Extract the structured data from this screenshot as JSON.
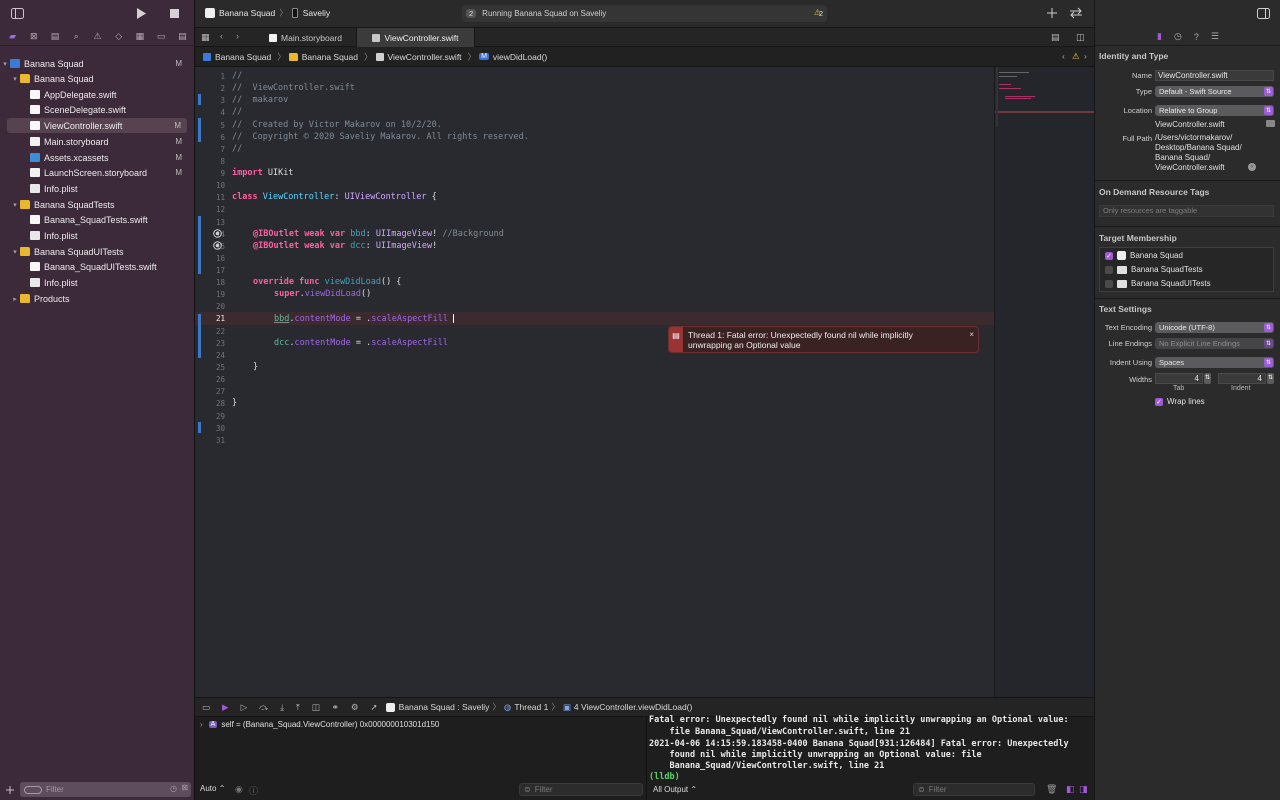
{
  "toolbar": {
    "scheme_name": "Banana Squad",
    "device_name": "Saveliy",
    "activity_count": "2",
    "activity_text": "Running Banana Squad on Saveliy",
    "warning_count": "2",
    "run_icon": "play-icon",
    "stop_icon": "stop-icon"
  },
  "tabs": [
    {
      "label": "Main.storyboard"
    },
    {
      "label": "ViewController.swift"
    }
  ],
  "jumpbar": {
    "crumbs": [
      "Banana Squad",
      "Banana Squad",
      "ViewController.swift",
      "viewDidLoad()"
    ],
    "method_badge": "M"
  },
  "navigator": {
    "items": [
      {
        "label": "Banana Squad",
        "flag": "M"
      },
      {
        "label": "Banana Squad",
        "flag": ""
      },
      {
        "label": "AppDelegate.swift",
        "flag": ""
      },
      {
        "label": "SceneDelegate.swift",
        "flag": ""
      },
      {
        "label": "ViewController.swift",
        "flag": "M"
      },
      {
        "label": "Main.storyboard",
        "flag": "M"
      },
      {
        "label": "Assets.xcassets",
        "flag": "M"
      },
      {
        "label": "LaunchScreen.storyboard",
        "flag": "M"
      },
      {
        "label": "Info.plist",
        "flag": ""
      },
      {
        "label": "Banana SquadTests",
        "flag": ""
      },
      {
        "label": "Banana_SquadTests.swift",
        "flag": ""
      },
      {
        "label": "Info.plist",
        "flag": ""
      },
      {
        "label": "Banana SquadUITests",
        "flag": ""
      },
      {
        "label": "Banana_SquadUITests.swift",
        "flag": ""
      },
      {
        "label": "Info.plist",
        "flag": ""
      },
      {
        "label": "Products",
        "flag": ""
      }
    ],
    "filter_placeholder": "Filter"
  },
  "editor": {
    "line_numbers": [
      "1",
      "2",
      "3",
      "4",
      "5",
      "6",
      "7",
      "8",
      "9",
      "10",
      "11",
      "12",
      "13",
      "14",
      "15",
      "16",
      "17",
      "18",
      "19",
      "20",
      "21",
      "22",
      "23",
      "24",
      "25",
      "26",
      "27",
      "28",
      "29",
      "30",
      "31"
    ],
    "code": {
      "l1": "//",
      "l2": "//  ViewController.swift",
      "l3": "//  makarov",
      "l4": "//",
      "l5": "//  Created by Victor Makarov on 10/2/20.",
      "l6": "//  Copyright © 2020 Saveliy Makarov. All rights reserved.",
      "l7": "//",
      "l9_kw": "import",
      "l9_rest": " UIKit",
      "l11_kw": "class",
      "l11_name": "ViewController",
      "l11_colon": ": ",
      "l11_super": "UIViewController",
      "l11_brace": " {",
      "l14_attr": "@IBOutlet",
      "l14_kw": "weak var",
      "l14_name": "bbd",
      "l14_colon": ": ",
      "l14_type": "UIImageView",
      "l14_bang": "! ",
      "l14_comment": "//Background",
      "l15_attr": "@IBOutlet",
      "l15_kw": "weak var",
      "l15_name": "dcc",
      "l15_colon": ": ",
      "l15_type": "UIImageView",
      "l15_bang": "!",
      "l18_kw": "override func",
      "l18_name": "viewDidLoad",
      "l18_rest": "() {",
      "l19_kw": "super",
      "l19_dot": ".",
      "l19_call": "viewDidLoad",
      "l19_rest": "()",
      "l21_var": "bbd",
      "l21_dot": ".",
      "l21_prop": "contentMode",
      "l21_eq": " = .",
      "l21_val": "scaleAspectFill",
      "l23_var": "dcc",
      "l23_dot": ".",
      "l23_prop": "contentMode",
      "l23_eq": " = .",
      "l23_val": "scaleAspectFill",
      "l25": "}",
      "l28": "}"
    },
    "error_message": "Thread 1: Fatal error: Unexpectedly found nil while implicitly unwrapping an Optional value"
  },
  "debugbar": {
    "process": "Banana Squad : Saveliy",
    "thread": "Thread 1",
    "frame": "4 ViewController.viewDidLoad()"
  },
  "variables": {
    "row": "self = (Banana_Squad.ViewController) 0x000000010301d150",
    "badge": "A",
    "mode": "Auto",
    "filter_placeholder": "Filter"
  },
  "console": {
    "lines": [
      "Fatal error: Unexpectedly found nil while implicitly unwrapping an Optional value:",
      "    file Banana_Squad/ViewController.swift, line 21",
      "2021-04-06 14:15:59.183458-0400 Banana Squad[931:126484] Fatal error: Unexpectedly",
      "    found nil while implicitly unwrapping an Optional value: file",
      "    Banana_Squad/ViewController.swift, line 21",
      "(lldb)"
    ],
    "output_mode": "All Output",
    "filter_placeholder": "Filter"
  },
  "inspector": {
    "identity_heading": "Identity and Type",
    "name_label": "Name",
    "name_value": "ViewController.swift",
    "type_label": "Type",
    "type_value": "Default - Swift Source",
    "location_label": "Location",
    "location_value": "Relative to Group",
    "location_file": "ViewController.swift",
    "fullpath_label": "Full Path",
    "fullpath_lines": [
      "/Users/victormakarov/",
      "Desktop/Banana Squad/",
      "Banana Squad/",
      "ViewController.swift"
    ],
    "odr_heading": "On Demand Resource Tags",
    "odr_placeholder": "Only resources are taggable",
    "target_heading": "Target Membership",
    "targets": [
      {
        "label": "Banana Squad",
        "checked": true
      },
      {
        "label": "Banana SquadTests",
        "checked": false
      },
      {
        "label": "Banana SquadUITests",
        "checked": false
      }
    ],
    "text_heading": "Text Settings",
    "encoding_label": "Text Encoding",
    "encoding_value": "Unicode (UTF-8)",
    "line_endings_label": "Line Endings",
    "line_endings_value": "No Explicit Line Endings",
    "indent_label": "Indent Using",
    "indent_value": "Spaces",
    "widths_label": "Widths",
    "tab_width": "4",
    "indent_width": "4",
    "tab_caption": "Tab",
    "indent_caption": "Indent",
    "wrap_label": "Wrap lines",
    "wrap_checked": true
  },
  "colors": {
    "accent": "#a258d4",
    "sidebar_bg": "#3c2a3a",
    "editor_bg": "#292a30",
    "error_bg": "#3a2223",
    "change_bar": "#3c78c8"
  }
}
